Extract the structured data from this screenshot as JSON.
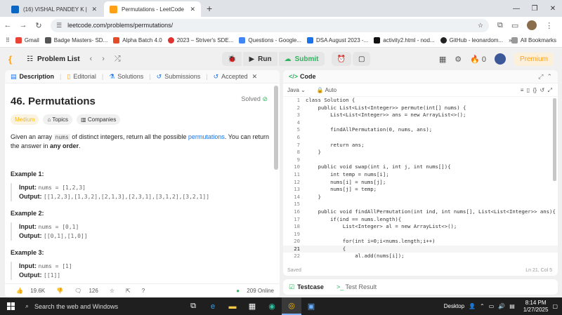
{
  "browser": {
    "tabs": [
      {
        "title": "(16) VISHAL PANDEY K | Linked",
        "icon_color": "#0a66c2"
      },
      {
        "title": "Permutations - LeetCode",
        "icon_color": "#ffa116"
      }
    ],
    "url": "leetcode.com/problems/permutations/",
    "bookmarks": [
      {
        "label": "Gmail",
        "color": "#ea4335"
      },
      {
        "label": "Badge Masters- SD...",
        "color": "#555"
      },
      {
        "label": "Alpha Batch 4.0",
        "color": "#e34c26"
      },
      {
        "label": "2023 – Striver's SDE...",
        "color": "#d33"
      },
      {
        "label": "Questions - Google...",
        "color": "#4285f4"
      },
      {
        "label": "DSA August 2023 -...",
        "color": "#1a73e8"
      },
      {
        "label": "activity2.html - nod...",
        "color": "#111"
      },
      {
        "label": "GitHub - leonardom...",
        "color": "#222"
      }
    ],
    "all_bookmarks": "All Bookmarks"
  },
  "nav": {
    "problem_list": "Problem List",
    "run": "Run",
    "submit": "Submit",
    "streak": "0",
    "premium": "Premium"
  },
  "left": {
    "tabs": [
      "Description",
      "Editorial",
      "Solutions",
      "Submissions",
      "Accepted"
    ],
    "title": "46. Permutations",
    "solved": "Solved",
    "chips": [
      "Medium",
      "Topics",
      "Companies"
    ],
    "desc_before": "Given an array ",
    "desc_code": "nums",
    "desc_mid": " of distinct integers, return all the possible ",
    "desc_link": "permutations",
    "desc_after": ". You can return the answer in ",
    "desc_bold": "any order",
    "desc_end": ".",
    "examples": [
      {
        "title": "Example 1:",
        "input": "nums = [1,2,3]",
        "output": "[[1,2,3],[1,3,2],[2,1,3],[2,3,1],[3,1,2],[3,2,1]]"
      },
      {
        "title": "Example 2:",
        "input": "nums = [0,1]",
        "output": "[[0,1],[1,0]]"
      },
      {
        "title": "Example 3:",
        "input": "nums = [1]",
        "output": "[[1]]"
      }
    ],
    "input_label": "Input:",
    "output_label": "Output:",
    "likes": "19.6K",
    "comments": "126",
    "online": "209 Online"
  },
  "right": {
    "header": "Code",
    "lang": "Java",
    "auto": "Auto",
    "status": "Saved",
    "cursor": "Ln 21, Col 5",
    "lines": [
      "class Solution {",
      "    public List<List<Integer>> permute(int[] nums) {",
      "        List<List<Integer>> ans = new ArrayList<>();",
      "",
      "        findAllPermutation(0, nums, ans);",
      "",
      "        return ans;",
      "    }",
      "",
      "    public void swap(int i, int j, int nums[]){",
      "        int temp = nums[i];",
      "        nums[i] = nums[j];",
      "        nums[j] = temp;",
      "    }",
      "",
      "    public void findAllPermutation(int ind, int nums[], List<List<Integer>> ans){",
      "        if(ind == nums.length){",
      "            List<Integer> al = new ArrayList<>();",
      "",
      "            for(int i=0;i<nums.length;i++)",
      "            {",
      "                al.add(nums[i]);"
    ],
    "current_line": 21
  },
  "test": {
    "testcase": "Testcase",
    "result": "Test Result"
  },
  "taskbar": {
    "search": "Search the web and Windows",
    "desktop": "Desktop",
    "time": "8:14 PM",
    "date": "1/27/2025"
  }
}
